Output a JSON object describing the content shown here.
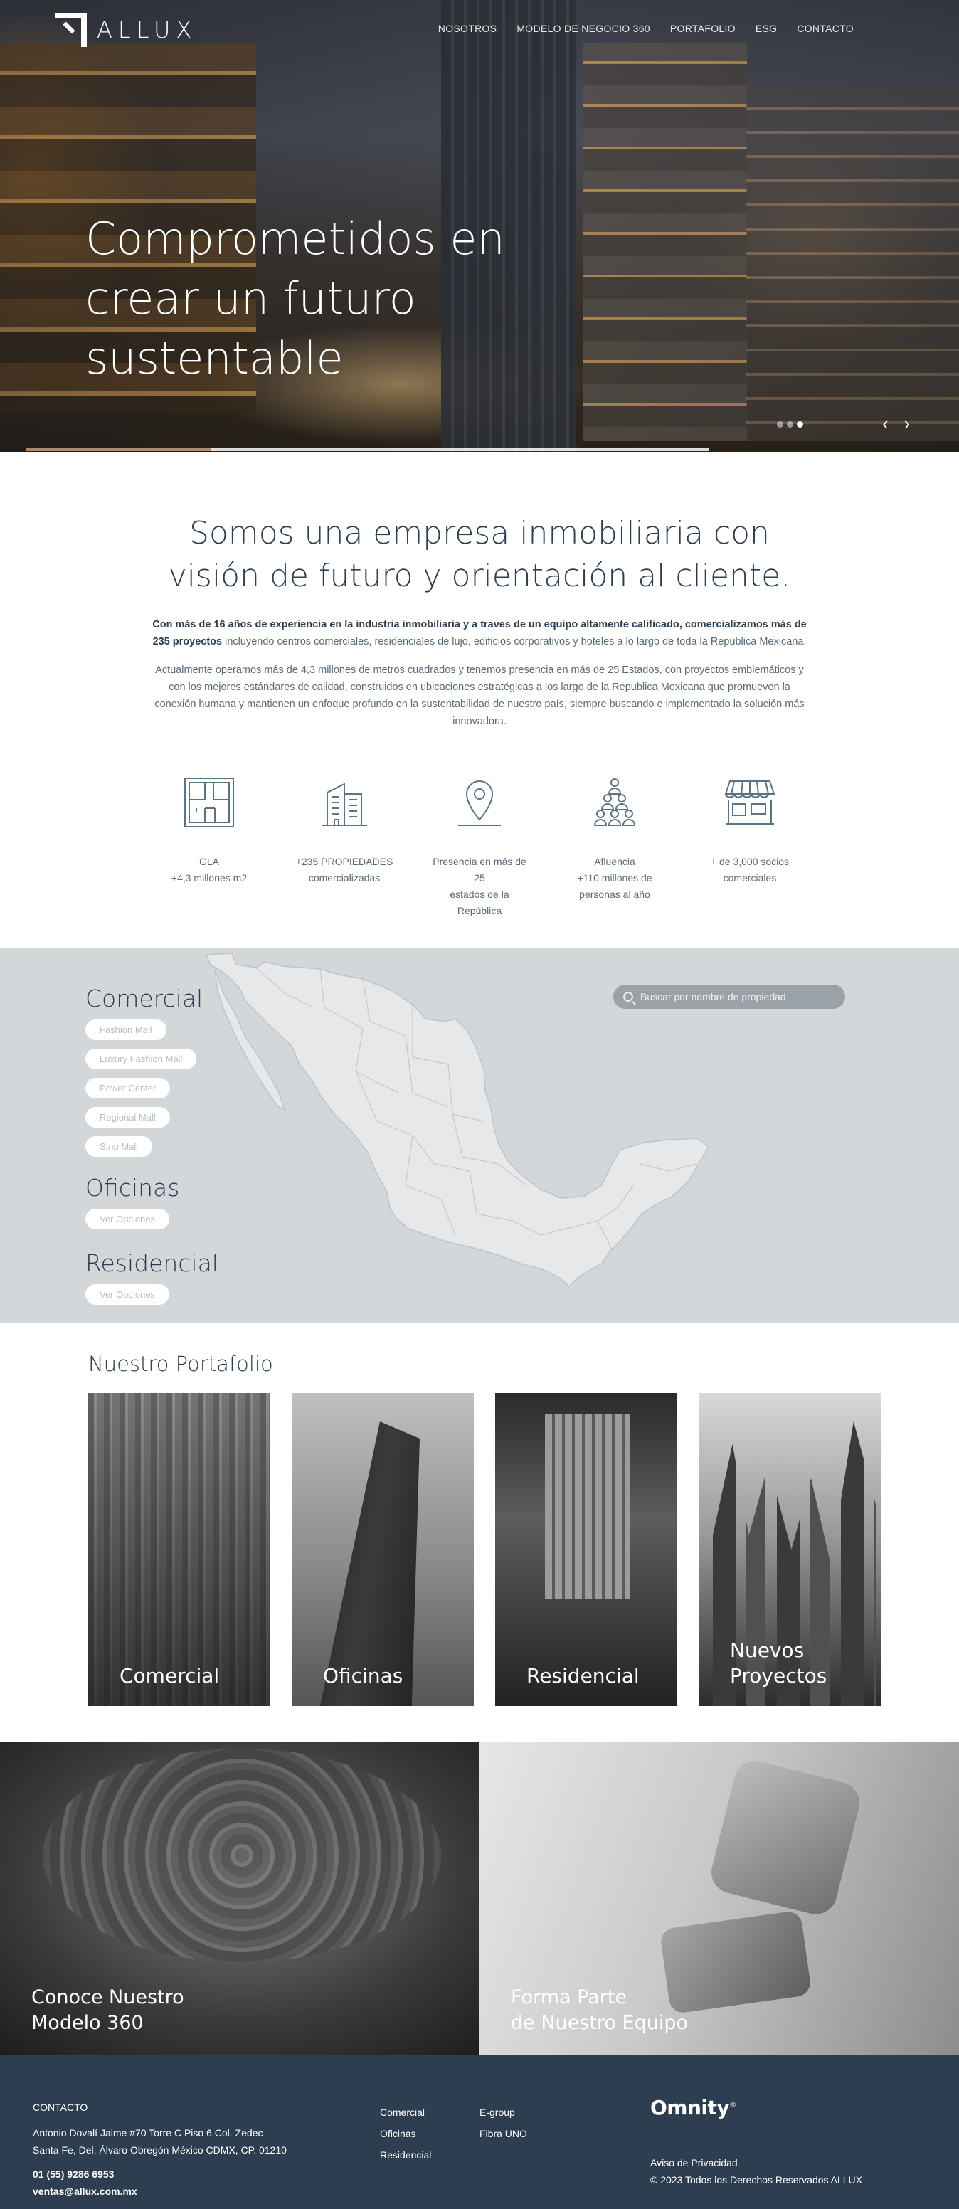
{
  "brand": {
    "logo_text": "ALLUX"
  },
  "nav": {
    "items": [
      "NOSOTROS",
      "MODELO DE NEGOCIO 360",
      "PORTAFOLIO",
      "ESG",
      "CONTACTO"
    ]
  },
  "hero": {
    "title_lines": [
      "Comprometidos en",
      "crear un futuro",
      "sustentable"
    ],
    "prev_arrow": "‹",
    "next_arrow": "›",
    "slide_count": 3,
    "active_slide": 3
  },
  "intro": {
    "heading_lines": [
      "Somos una empresa inmobiliaria con",
      "visión de futuro y orientación al cliente."
    ],
    "p1_bold": "Con más de 16 años de experiencia en la industria inmobiliaria y a traves de un equipo altamente calificado, comercializamos más de 235 proyectos",
    "p1_rest": " incluyendo centros comerciales, residenciales de lujo, edificios corporativos y hoteles a lo largo de toda la Republica Mexicana.",
    "p2": "Actualmente operamos más de 4,3 millones de metros cuadrados y tenemos presencia en más de 25 Estados, con proyectos emblemáticos y con los mejores estándares de calidad, construidos en ubicaciones estratégicas a los largo de la Republica Mexicana que promueven la conexión humana y mantienen un enfoque profundo en la sustentabilidad de nuestro país, siempre buscando e implementado la solución más innovadora."
  },
  "stats": [
    {
      "icon": "floorplan-icon",
      "lines": [
        "GLA",
        "+4,3 millones m2"
      ]
    },
    {
      "icon": "building-icon",
      "lines": [
        "+235 PROPIEDADES",
        "comercializadas"
      ]
    },
    {
      "icon": "map-pin-icon",
      "lines": [
        "Presencia en más de 25",
        "estados de la República"
      ]
    },
    {
      "icon": "people-icon",
      "lines": [
        "Afluencia",
        "+110 millones de",
        "personas al año"
      ]
    },
    {
      "icon": "store-icon",
      "lines": [
        "+ de 3,000 socios",
        "comerciales"
      ]
    }
  ],
  "map": {
    "search_placeholder": "Buscar por nombre de propiedad",
    "comercial": {
      "title": "Comercial",
      "options": [
        "Fashion Mall",
        "Luxury Fashion Mall",
        "Power Center",
        "Regional Mall",
        "Strip Mall"
      ]
    },
    "oficinas": {
      "title": "Oficinas",
      "option": "Ver Opciones"
    },
    "residencial": {
      "title": "Residencial",
      "option": "Ver Opciones"
    }
  },
  "portfolio": {
    "title": "Nuestro Portafolio",
    "cards": [
      [
        "Comercial"
      ],
      [
        "Oficinas"
      ],
      [
        "Residencial"
      ],
      [
        "Nuevos",
        "Proyectos"
      ]
    ]
  },
  "promos": [
    {
      "lines": [
        "Conoce Nuestro",
        "Modelo 360"
      ]
    },
    {
      "lines": [
        "Forma Parte",
        "de Nuestro Equipo"
      ]
    }
  ],
  "footer": {
    "contact_title": "CONTACTO",
    "address_1": "Antonio Dovalí Jaime #70 Torre C Piso 6 Col. Zedec",
    "address_2": "Santa Fe, Del. Álvaro Obregón México CDMX, CP. 01210",
    "phone": "01 (55) 9286 6953",
    "email": "ventas@allux.com.mx",
    "links_a": [
      "Comercial",
      "Oficinas",
      "Residencial"
    ],
    "links_b": [
      "E-group",
      "Fibra UNO"
    ],
    "partner": "Omnity",
    "partner_mark": "®",
    "privacy": "Aviso de Privacidad",
    "copyright": "© 2023 Todos los Derechos Reservados ALLUX"
  },
  "colors": {
    "navy": "#2c3e50",
    "map_bg": "#d4d7d9",
    "icon_stroke": "#5b7383"
  }
}
